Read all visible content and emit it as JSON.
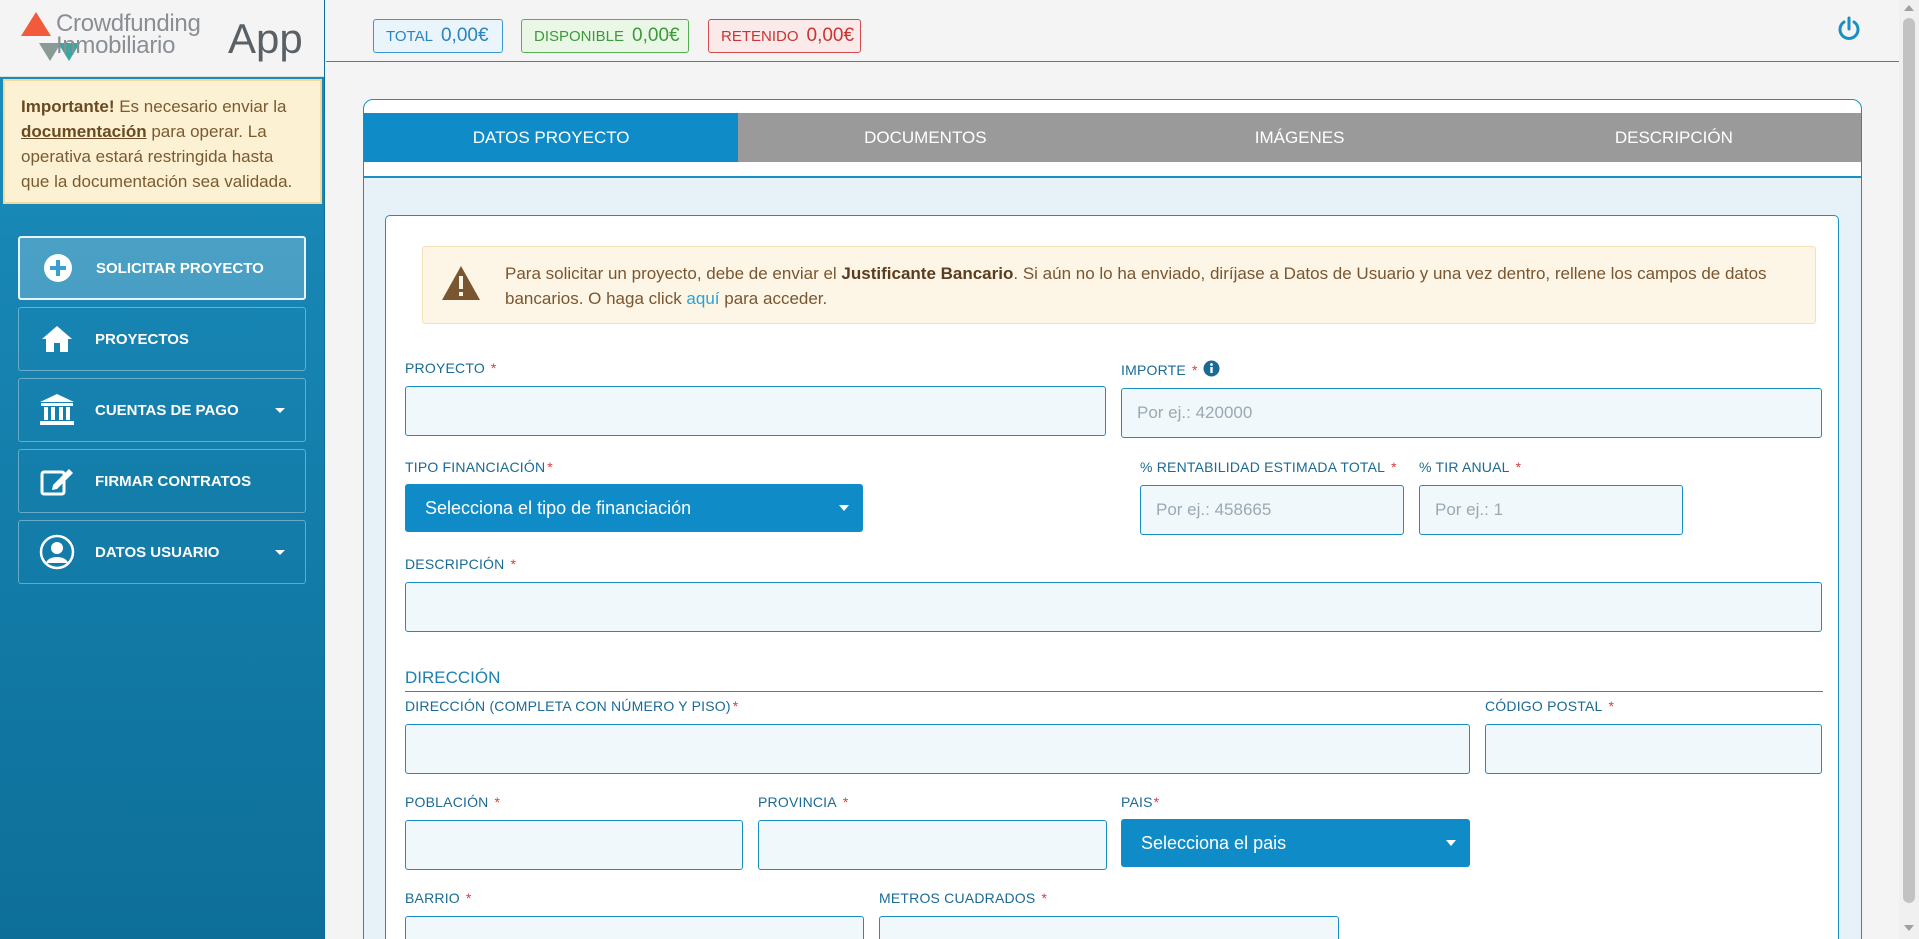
{
  "logo": {
    "line1": "Crowdfunding",
    "line2": "Inmobiliario",
    "app": "App"
  },
  "notice": {
    "strong": "Importante!",
    "text1": " Es necesario enviar la ",
    "link": "documentación",
    "text2": " para operar. La operativa estará restringida hasta que la documentación sea validada."
  },
  "nav": {
    "items": [
      {
        "label": "SOLICITAR PROYECTO",
        "icon": "plus-circle-icon"
      },
      {
        "label": "PROYECTOS",
        "icon": "home-icon"
      },
      {
        "label": "CUENTAS DE PAGO",
        "icon": "bank-icon"
      },
      {
        "label": "FIRMAR CONTRATOS",
        "icon": "edit-icon"
      },
      {
        "label": "DATOS USUARIO",
        "icon": "user-icon"
      }
    ]
  },
  "balances": {
    "total_label": "TOTAL",
    "total_value": "0,00€",
    "disp_label": "DISPONIBLE",
    "disp_value": "0,00€",
    "ret_label": "RETENIDO",
    "ret_value": "0,00€"
  },
  "colors": {
    "accent": "#0f8cc8",
    "sidebar": "#1580ad",
    "tab_inactive": "#9a9a9a",
    "required": "#e23a3a"
  },
  "tabs": [
    "DATOS PROYECTO",
    "DOCUMENTOS",
    "IMÁGENES",
    "DESCRIPCIÓN"
  ],
  "warning": {
    "t1": "Para solicitar un proyecto, debe de enviar el ",
    "bold": "Justificante Bancario",
    "t2": ". Si aún no lo ha enviado, diríjase a Datos de Usuario y una vez dentro, rellene los campos de datos bancarios. O haga click ",
    "link": "aquí",
    "t3": " para acceder."
  },
  "form": {
    "proyecto": "PROYECTO",
    "importe": "IMPORTE",
    "importe_ph": "Por ej.: 420000",
    "tipo": "TIPO FINANCIACIÓN",
    "tipo_select": "Selecciona el tipo de financiación",
    "rentabilidad": "% RENTABILIDAD ESTIMADA TOTAL",
    "rentabilidad_ph": "Por ej.: 458665",
    "tir": "% TIR ANUAL",
    "tir_ph": "Por ej.: 1",
    "descripcion": "DESCRIPCIÓN",
    "section_direccion": "DIRECCIÓN",
    "direccion": "DIRECCIÓN (COMPLETA CON NÚMERO Y PISO)",
    "cp": "CÓDIGO POSTAL",
    "poblacion": "POBLACIÓN",
    "provincia": "PROVINCIA",
    "pais": "PAIS",
    "pais_select": "Selecciona el pais",
    "barrio": "BARRIO",
    "metros": "METROS CUADRADOS",
    "required_mark": "*"
  }
}
